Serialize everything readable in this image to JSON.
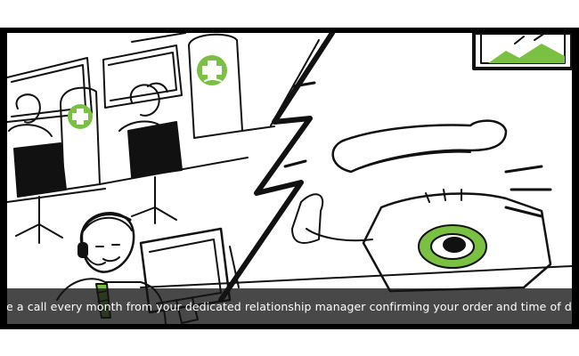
{
  "scene": {
    "caption": "Receive a call every month from your dedicated relationship manager confirming your order and time of delivery",
    "accent_color": "#7ac143",
    "icons": [
      "pharmacy-cross-icon",
      "telephone-icon",
      "headset-icon",
      "lightning-bolt-icon",
      "framed-picture-icon"
    ]
  }
}
